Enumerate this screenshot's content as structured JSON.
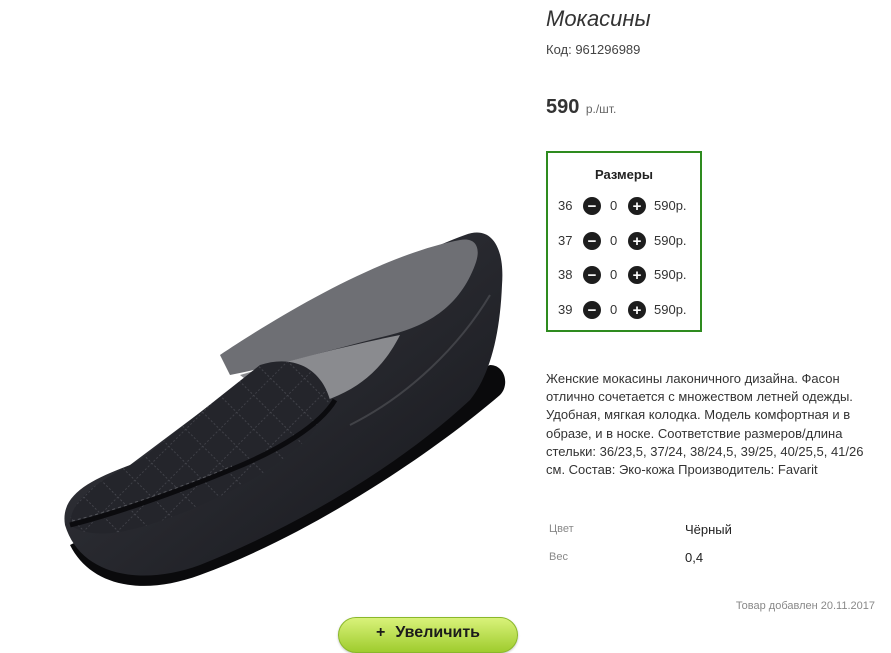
{
  "product": {
    "title": "Мокасины",
    "code": "Код: 961296989",
    "price": "590",
    "price_unit": "р./шт."
  },
  "sizes": {
    "title": "Размеры",
    "rows": [
      {
        "size": "36",
        "qty": "0",
        "price": "590р."
      },
      {
        "size": "37",
        "qty": "0",
        "price": "590р."
      },
      {
        "size": "38",
        "qty": "0",
        "price": "590р."
      },
      {
        "size": "39",
        "qty": "0",
        "price": "590р."
      }
    ]
  },
  "description": "Женские мокасины лаконичного дизайна. Фасон отлично сочетается с множеством летней одежды. Удобная, мягкая колодка. Модель комфортная и в образе, и в носке. Соответствие размеров/длина стельки: 36/23,5, 37/24, 38/24,5, 39/25, 40/25,5, 41/26 см. Состав: Эко-кожа Производитель: Favarit",
  "attributes": [
    {
      "label": "Цвет",
      "value": "Чёрный"
    },
    {
      "label": "Вес",
      "value": "0,4"
    }
  ],
  "added": "Товар добавлен 20.11.2017",
  "zoom_button": {
    "icon": "+",
    "label": "Увеличить"
  },
  "colors": {
    "accent_border": "#2e8b1f",
    "zoom_button": "#b6e04a"
  }
}
